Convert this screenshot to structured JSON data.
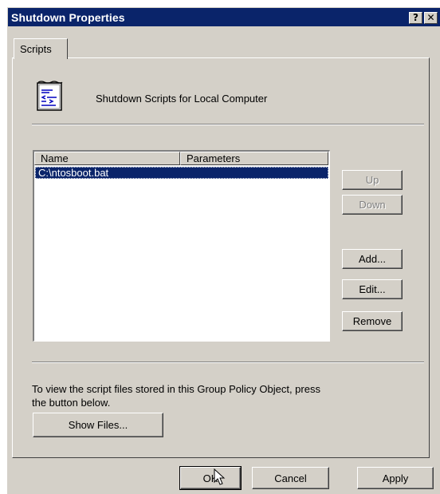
{
  "window": {
    "title": "Shutdown Properties",
    "help_glyph": "?",
    "close_glyph": "✕"
  },
  "tabs": [
    {
      "label": "Scripts"
    }
  ],
  "header": {
    "text": "Shutdown Scripts for Local Computer",
    "icon": "script-document-icon"
  },
  "list": {
    "columns": [
      "Name",
      "Parameters"
    ],
    "rows": [
      {
        "name": "C:\\ntosboot.bat",
        "parameters": "",
        "selected": true
      }
    ]
  },
  "side_buttons": {
    "up": "Up",
    "down": "Down",
    "add": "Add...",
    "edit": "Edit...",
    "remove": "Remove"
  },
  "info": {
    "line1": "To view the script files stored in this Group Policy Object, press",
    "line2": "the button below.",
    "show_files": "Show Files..."
  },
  "footer": {
    "ok": "OK",
    "cancel": "Cancel",
    "apply": "Apply"
  },
  "colors": {
    "titlebar": "#0a246a",
    "face": "#d4d0c8",
    "selection": "#0a246a"
  }
}
